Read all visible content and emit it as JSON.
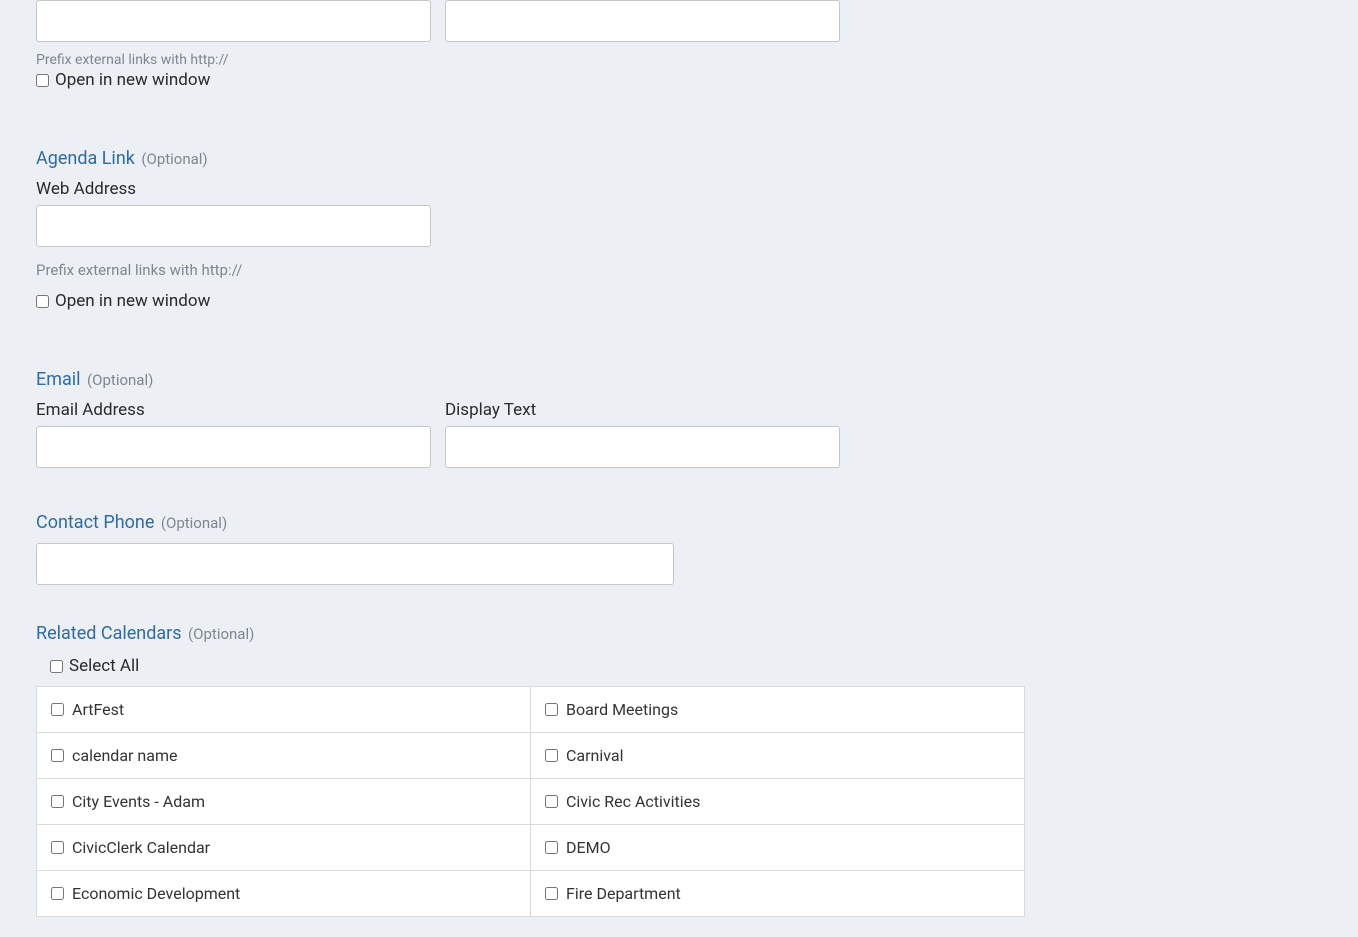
{
  "topRow": {},
  "hintTop": "Prefix external links with http://",
  "openNewWindowTop": "Open in new window",
  "agendaLink": {
    "title": "Agenda Link",
    "optional": "(Optional)",
    "webAddressLabel": "Web Address",
    "hint": "Prefix external links with http://",
    "openNewWindow": "Open in new window"
  },
  "email": {
    "title": "Email",
    "optional": "(Optional)",
    "emailAddressLabel": "Email Address",
    "displayTextLabel": "Display Text"
  },
  "contactPhone": {
    "title": "Contact Phone",
    "optional": "(Optional)"
  },
  "relatedCalendars": {
    "title": "Related Calendars",
    "optional": "(Optional)",
    "selectAll": "Select All",
    "items": [
      [
        "ArtFest",
        "Board Meetings"
      ],
      [
        "calendar name",
        "Carnival"
      ],
      [
        "City Events - Adam",
        "Civic Rec Activities"
      ],
      [
        "CivicClerk Calendar",
        "DEMO"
      ],
      [
        "Economic Development",
        "Fire Department"
      ]
    ]
  }
}
